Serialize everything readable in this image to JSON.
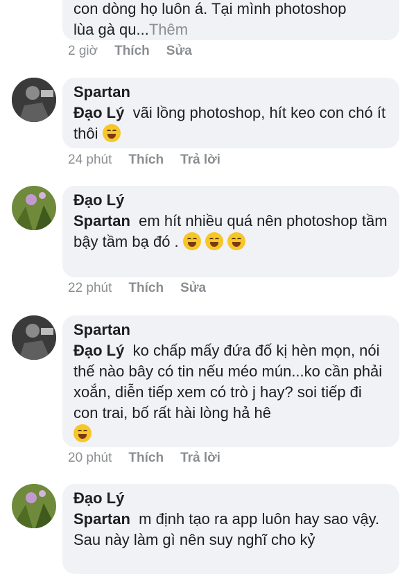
{
  "comments": [
    {
      "author": "",
      "line1": "con dòng họ luôn á. Tại mình photoshop",
      "line2": "lùa gà qu...",
      "more": "Thêm",
      "time": "2 giờ",
      "like": "Thích",
      "action": "Sửa"
    },
    {
      "author": "Spartan",
      "tag": "Đạo Lý",
      "text": "vãi lồng photoshop, hít keo con chó ít thôi",
      "time": "24 phút",
      "like": "Thích",
      "action": "Trả lời"
    },
    {
      "author": "Đạo Lý",
      "tag": "Spartan",
      "text": "em hít nhiều quá nên photoshop tầm bậy tầm bạ đó .",
      "time": "22 phút",
      "like": "Thích",
      "action": "Sửa"
    },
    {
      "author": "Spartan",
      "tag": "Đạo Lý",
      "text": "ko chấp mấy đứa đố kị hèn mọn, nói thế nào bây có tin nếu méo mún...ko cần phải xoắn, diễn tiếp xem có trò j hay? soi tiếp đi con trai, bố rất hài lòng hả hê",
      "time": "20 phút",
      "like": "Thích",
      "action": "Trả lời"
    },
    {
      "author": "Đạo Lý",
      "tag": "Spartan",
      "text": "m định tạo ra app luôn hay sao vậy. Sau này làm gì nên suy nghĩ cho kỷ"
    }
  ]
}
